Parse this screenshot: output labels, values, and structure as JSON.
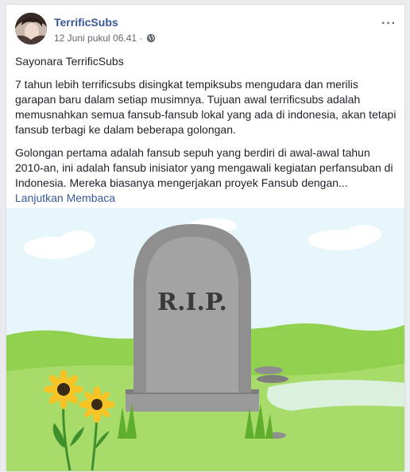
{
  "post": {
    "author": "TerrificSubs",
    "timestamp": "12 Juni pukul 06.41",
    "privacy_icon": "globe-icon",
    "more_label": "···",
    "title": "Sayonara TerrificSubs",
    "paragraph1": "7 tahun lebih terrificsubs disingkat tempiksubs mengudara dan merilis garapan baru dalam setiap musimnya. Tujuan awal terrificsubs adalah memusnahkan semua fansub-fansub lokal yang ada di indonesia, akan tetapi fansub terbagi ke dalam beberapa golongan.",
    "paragraph2": "Golongan pertama adalah fansub sepuh yang berdiri di awal-awal tahun 2010-an, ini adalah fansub inisiator yang mengawali kegiatan perfansuban di Indonesia. Mereka biasanya mengerjakan proyek Fansub dengan...",
    "read_more": "Lanjutkan Membaca"
  },
  "image": {
    "tombstone_text": "R.I.P.",
    "sky_color": "#e7f6fb",
    "grass_color": "#92d050",
    "stone_color": "#8f8f8f",
    "flower_petal_color": "#f7c325",
    "flower_center_color": "#3a2b16"
  }
}
